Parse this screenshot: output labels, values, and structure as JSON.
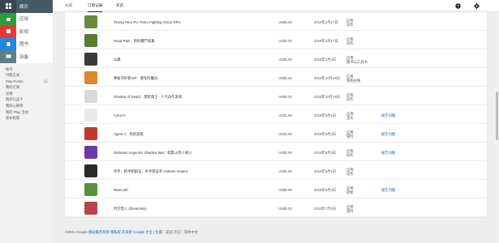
{
  "sidebar": {
    "categories": [
      {
        "label": "娱乐",
        "icon": "apps-grid-icon"
      },
      {
        "label": "应用",
        "icon": "android-icon"
      },
      {
        "label": "影视",
        "icon": "film-icon"
      },
      {
        "label": "图书",
        "icon": "book-icon"
      },
      {
        "label": "设备",
        "icon": "device-icon"
      }
    ],
    "nav": [
      {
        "label": "帐号"
      },
      {
        "label": "付款方式"
      },
      {
        "label": "Play Points"
      },
      {
        "label": "我的订阅"
      },
      {
        "label": "兑换"
      },
      {
        "label": "购买礼品卡"
      },
      {
        "label": "我的心愿单"
      },
      {
        "label": "我的 Play 活动"
      },
      {
        "label": "家长指南"
      }
    ]
  },
  "topbar": {
    "tabs": [
      {
        "label": "从前",
        "active": false
      },
      {
        "label": "订单记录",
        "active": true
      },
      {
        "label": "家庭",
        "active": false
      }
    ],
    "help_icon": "?",
    "settings_icon": "⚙"
  },
  "orders": [
    {
      "title": "Timing Hero PV: Retro Fighting Action RPG",
      "price": "US$0.00",
      "date": "2019年2月17日",
      "cat1": "应用",
      "cat2": "动作",
      "action": "",
      "color": "#6a8a3a"
    },
    {
      "title": "Dead Rain：新的僵尸病毒",
      "price": "US$0.00",
      "date": "2019年2月17日",
      "cat1": "应用",
      "cat2": "动作",
      "action": "",
      "color": "#5c7c34"
    },
    {
      "title": "公模",
      "price": "US$0.00",
      "date": "2019年2月4日",
      "cat1": "应用",
      "cat2": "图书与工具书",
      "action": "",
      "color": "#3a3a3a"
    },
    {
      "title": "神秘守护者VIP：重生的魔法",
      "price": "US$0.00",
      "date": "2019年10月19日",
      "cat1": "应用",
      "cat2": "角色扮演",
      "action": "",
      "color": "#d98a2a"
    },
    {
      "title": "Shadow of Death：黑暗骑士 - 人气动作游戏",
      "price": "US$0.00",
      "date": "2019年10月19日",
      "cat1": "应用",
      "cat2": "动作",
      "action": "",
      "color": "#d9d9d9"
    },
    {
      "title": "Cytus II",
      "price": "US$1.99",
      "date": "2019年9月1日",
      "cat1": "应用",
      "cat2": "音乐",
      "action": "报告问题",
      "color": "#e9e9e9"
    },
    {
      "title": "Agent A：伪装游戏",
      "price": "US$4.99",
      "date": "2019年8月3日",
      "cat1": "应用",
      "cat2": "冒险",
      "action": "报告问题",
      "color": "#c0392b"
    },
    {
      "title": "Stickman Legends: Shadow War：暗影火柴人格斗",
      "price": "US$0.99",
      "date": "2019年8月3日",
      "cat1": "应用",
      "cat2": "动作",
      "action": "报告问题",
      "color": "#6a3aa8"
    },
    {
      "title": "杀手、枪手和狙击：杀手狙击手 (Hitman Sniper)",
      "price": "US$0.99",
      "date": "2019年8月1日",
      "cat1": "应用",
      "cat2": "动作",
      "action": "",
      "color": "#2b2b2b"
    },
    {
      "title": "Minecraft",
      "price": "US$6.99",
      "date": "2019年8月3日",
      "cat1": "应用",
      "cat2": "街机",
      "action": "报告问题",
      "color": "#5a8f3a"
    },
    {
      "title": "时空猎人 (Dreamsky)",
      "price": "US$0.00",
      "date": "2019年7月2日",
      "cat1": "应用",
      "cat2": "冒险",
      "action": "",
      "color": "#b8434a"
    }
  ],
  "footer": {
    "copyright": "©2021 Google",
    "links": "网站服务条款 隐私权 开发者 Google 大全",
    "rest": "| 位置：美国 语言：简体中文"
  }
}
